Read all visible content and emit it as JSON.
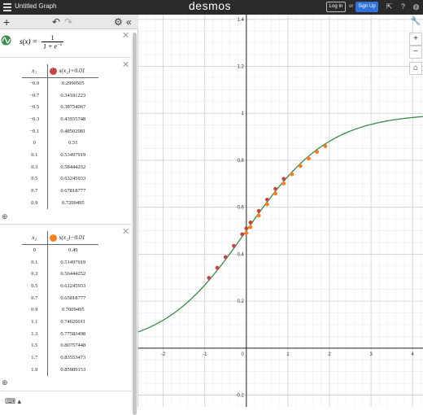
{
  "topbar": {
    "title": "Untitled Graph",
    "logo": "desmos",
    "login_label": "Log In",
    "or_label": "or",
    "signup_label": "Sign Up"
  },
  "expression1": {
    "lhs": "s(x) =",
    "numerator": "1",
    "denominator": "1 + e",
    "exponent": "−x"
  },
  "table1": {
    "col1_header": "x₁",
    "col2_header": "s(x₁)+0.01",
    "color": "#c74440",
    "rows": [
      [
        "−0.9",
        "0.2990505"
      ],
      [
        "−0.7",
        "0.34181223"
      ],
      [
        "−0.5",
        "0.38754067"
      ],
      [
        "−0.3",
        "0.43555748"
      ],
      [
        "−0.1",
        "0.48502081"
      ],
      [
        "0",
        "0.51"
      ],
      [
        "0.1",
        "0.53497919"
      ],
      [
        "0.3",
        "0.58444252"
      ],
      [
        "0.5",
        "0.63245933"
      ],
      [
        "0.7",
        "0.67818777"
      ],
      [
        "0.9",
        "0.7209495"
      ]
    ]
  },
  "table2": {
    "col1_header": "x₂",
    "col2_header": "s(x₂)−0.01",
    "color": "#fa7e19",
    "rows": [
      [
        "0",
        "0.49"
      ],
      [
        "0.1",
        "0.51497919"
      ],
      [
        "0.3",
        "0.56444252"
      ],
      [
        "0.5",
        "0.61245933"
      ],
      [
        "0.7",
        "0.65818777"
      ],
      [
        "0.9",
        "0.7009495"
      ],
      [
        "1.1",
        "0.74026011"
      ],
      [
        "1.3",
        "0.77583498"
      ],
      [
        "1.5",
        "0.80757448"
      ],
      [
        "1.7",
        "0.83553473"
      ],
      [
        "1.9",
        "0.85989153"
      ]
    ]
  },
  "chart_data": {
    "type": "scatter",
    "xlim": [
      -2.6,
      4.25
    ],
    "ylim": [
      -0.25,
      1.42
    ],
    "x_ticks": [
      "-2",
      "-1",
      "1",
      "2",
      "3",
      "4"
    ],
    "x_tick_values": [
      -2,
      -1,
      1,
      2,
      3,
      4
    ],
    "y_ticks": [
      "-0.2",
      "0.2",
      "0.4",
      "0.6",
      "0.8",
      "1",
      "1.2",
      "1.4"
    ],
    "y_tick_values": [
      -0.2,
      0.2,
      0.4,
      0.6,
      0.8,
      1,
      1.2,
      1.4
    ],
    "origin_label": "0",
    "grid": true,
    "curve": {
      "function": "1/(1+e^-x)",
      "color": "#388c46"
    },
    "series": [
      {
        "color": "#c74440",
        "x": [
          -0.9,
          -0.7,
          -0.5,
          -0.3,
          -0.1,
          0,
          0.1,
          0.3,
          0.5,
          0.7,
          0.9
        ],
        "y": [
          0.2990505,
          0.34181223,
          0.38754067,
          0.43555748,
          0.48502081,
          0.51,
          0.53497919,
          0.58444252,
          0.63245933,
          0.67818777,
          0.7209495
        ]
      },
      {
        "color": "#fa7e19",
        "x": [
          0,
          0.1,
          0.3,
          0.5,
          0.7,
          0.9,
          1.1,
          1.3,
          1.5,
          1.7,
          1.9
        ],
        "y": [
          0.49,
          0.51497919,
          0.56444252,
          0.61245933,
          0.65818777,
          0.7009495,
          0.74026011,
          0.77583498,
          0.80757448,
          0.83553473,
          0.85989153
        ]
      }
    ]
  }
}
